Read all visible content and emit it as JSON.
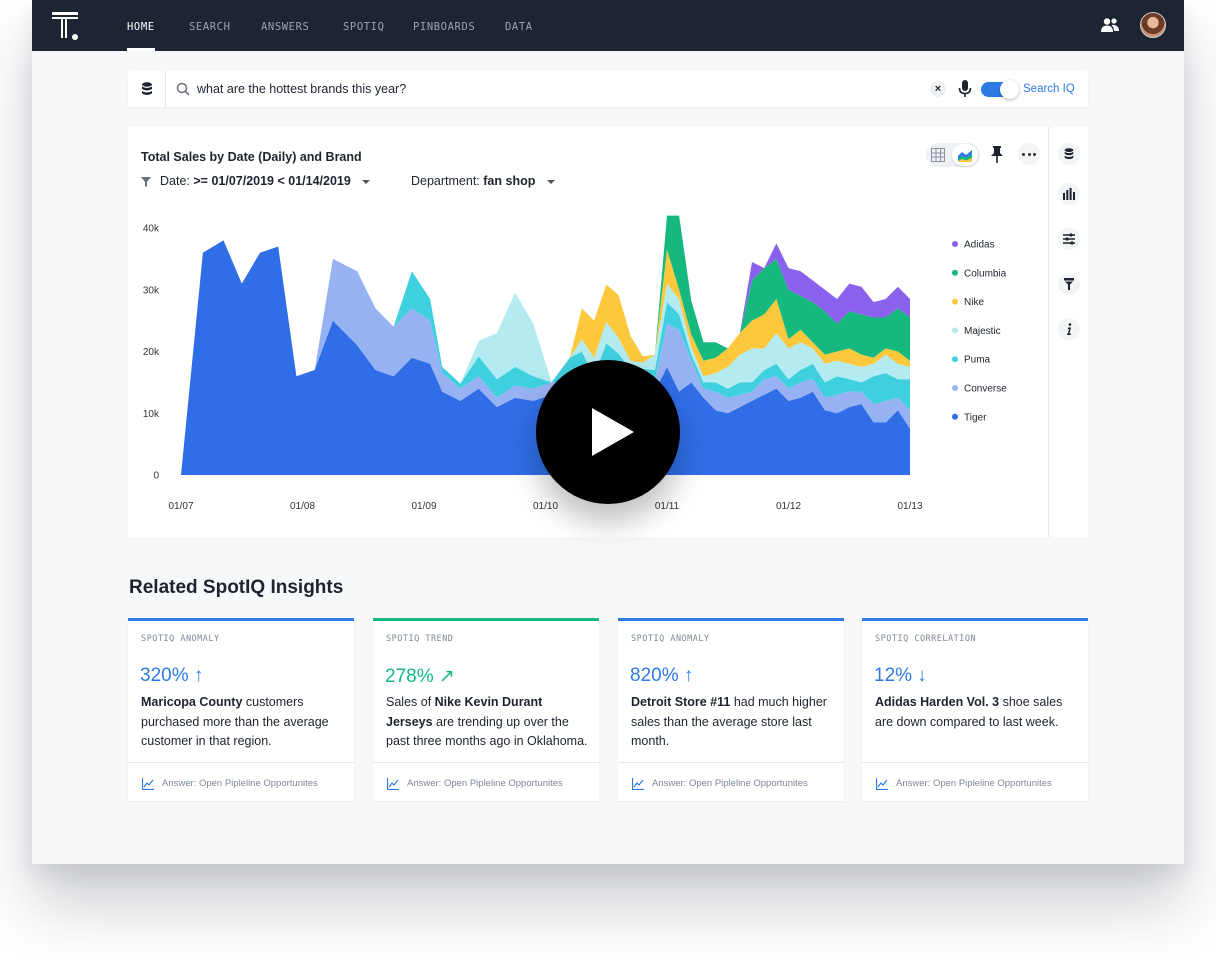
{
  "nav": {
    "items": [
      "HOME",
      "SEARCH",
      "ANSWERS",
      "SPOTIQ",
      "PINBOARDS",
      "DATA"
    ],
    "active": "HOME"
  },
  "search": {
    "query": "what are the hottest brands this year?",
    "clear_label": "×",
    "search_iq_label": "Search IQ",
    "search_iq_enabled": true
  },
  "chart_card": {
    "title": "Total Sales by Date (Daily) and Brand",
    "filters": [
      {
        "label": "Date:",
        "value": ">= 01/07/2019 < 01/14/2019"
      },
      {
        "label": "Department:",
        "value": "fan shop"
      }
    ]
  },
  "chart_data": {
    "type": "area",
    "stacked": true,
    "title": "Total Sales by Date (Daily) and Brand",
    "x_ticks": [
      "01/07",
      "01/08",
      "01/09",
      "01/10",
      "01/11",
      "01/12",
      "01/13"
    ],
    "y_ticks": [
      "0",
      "10k",
      "20k",
      "30k",
      "40k"
    ],
    "ylim": [
      0,
      40000
    ],
    "legend_position": "right",
    "x": [
      0,
      0.18,
      0.35,
      0.5,
      0.65,
      0.8,
      0.95,
      1.1,
      1.25,
      1.45,
      1.6,
      1.75,
      1.9,
      2.05,
      2.15,
      2.3,
      2.45,
      2.6,
      2.75,
      2.9,
      3.05,
      3.2,
      3.3,
      3.4,
      3.5,
      3.6,
      3.7,
      3.8,
      3.9,
      4.0,
      4.1,
      4.2,
      4.3,
      4.4,
      4.5,
      4.6,
      4.7,
      4.8,
      4.9,
      5.0,
      5.1,
      5.2,
      5.3,
      5.4,
      5.5,
      5.6,
      5.7,
      5.8,
      5.9,
      6.0
    ],
    "series": [
      {
        "name": "Tiger",
        "color": "#2f6ee6",
        "values": [
          0,
          36000,
          38000,
          31000,
          36000,
          37000,
          16000,
          17000,
          25000,
          21000,
          17000,
          16000,
          19000,
          18000,
          13500,
          12000,
          14000,
          11000,
          12500,
          12000,
          13000,
          13500,
          12000,
          11500,
          15500,
          14500,
          13500,
          14000,
          13500,
          17500,
          13500,
          15000,
          12500,
          10500,
          10000,
          11000,
          12000,
          13000,
          14000,
          12000,
          12500,
          13500,
          10500,
          10000,
          11000,
          11500,
          8500,
          8500,
          10500,
          7500
        ]
      },
      {
        "name": "Converse",
        "color": "#97b2f3",
        "values": [
          0,
          0,
          0,
          0,
          0,
          0,
          0,
          0,
          10000,
          12000,
          10000,
          8000,
          8000,
          7000,
          3000,
          2000,
          2000,
          1500,
          2000,
          2000,
          2000,
          1500,
          2500,
          1500,
          1800,
          2200,
          2000,
          2200,
          2000,
          7000,
          10000,
          3500,
          1500,
          3000,
          2500,
          2000,
          1500,
          2500,
          2000,
          2000,
          2500,
          2000,
          2000,
          3000,
          2500,
          2000,
          3000,
          3500,
          2000,
          3000
        ]
      },
      {
        "name": "Puma",
        "color": "#3fd0e0",
        "values": [
          0,
          0,
          0,
          0,
          0,
          0,
          0,
          0,
          0,
          0,
          0,
          0,
          6000,
          3500,
          1000,
          800,
          3200,
          3000,
          3000,
          2000,
          0,
          4000,
          5500,
          3000,
          4000,
          3000,
          1500,
          1000,
          1500,
          3500,
          2500,
          1000,
          1000,
          1500,
          1500,
          2000,
          1500,
          1500,
          2000,
          1500,
          2000,
          2500,
          2500,
          3000,
          2000,
          1500,
          4500,
          4500,
          3000,
          5000
        ]
      },
      {
        "name": "Majestic",
        "color": "#b3ebf0",
        "values": [
          0,
          0,
          0,
          0,
          0,
          0,
          0,
          0,
          0,
          0,
          0,
          0,
          0,
          0,
          0,
          0,
          2500,
          7500,
          12000,
          8500,
          0,
          0,
          2000,
          3000,
          3500,
          2500,
          1500,
          1000,
          2500,
          3000,
          2500,
          1200,
          1000,
          1500,
          3500,
          4500,
          5500,
          3500,
          5000,
          5000,
          4500,
          2500,
          3000,
          2500,
          2500,
          2500,
          2000,
          3000,
          2500,
          2000
        ]
      },
      {
        "name": "Nike",
        "color": "#fec83d",
        "values": [
          0,
          0,
          0,
          0,
          0,
          0,
          0,
          0,
          0,
          0,
          0,
          0,
          0,
          0,
          0,
          0,
          0,
          0,
          0,
          0,
          0,
          0,
          5000,
          6000,
          6000,
          7000,
          4000,
          1000,
          0,
          5500,
          1500,
          2000,
          2500,
          2500,
          3000,
          3500,
          4500,
          5500,
          5500,
          1500,
          2000,
          1000,
          1500,
          1500,
          2500,
          2000,
          1000,
          1000,
          2000,
          1000
        ]
      },
      {
        "name": "Columbia",
        "color": "#16b97d",
        "values": [
          0,
          0,
          0,
          0,
          0,
          0,
          0,
          0,
          0,
          0,
          0,
          0,
          0,
          0,
          0,
          0,
          0,
          0,
          0,
          0,
          0,
          0,
          0,
          0,
          0,
          0,
          0,
          0,
          0,
          5500,
          12000,
          5500,
          3000,
          2500,
          0,
          0,
          6500,
          7500,
          6500,
          8000,
          5500,
          6500,
          7000,
          4500,
          6000,
          6500,
          6500,
          5000,
          7000,
          7000
        ]
      },
      {
        "name": "Adidas",
        "color": "#8a61ec",
        "values": [
          0,
          0,
          0,
          0,
          0,
          0,
          0,
          0,
          0,
          0,
          0,
          0,
          0,
          0,
          0,
          0,
          0,
          0,
          0,
          0,
          0,
          0,
          0,
          0,
          0,
          0,
          0,
          0,
          0,
          0,
          0,
          0,
          0,
          0,
          0,
          0,
          3000,
          0,
          2500,
          3500,
          4000,
          3500,
          3500,
          4000,
          4500,
          4500,
          2500,
          3000,
          3500,
          3000
        ]
      }
    ]
  },
  "insights": {
    "title": "Related SpotIQ Insights",
    "cards": [
      {
        "kind": "SPOTIQ ANOMALY",
        "value": "320% ↑",
        "bold": "Maricopa County",
        "text": " customers purchased more than the average customer in that region.",
        "pre": "",
        "footer": "Answer: Open Pipleline Opportunites",
        "accent": "blue"
      },
      {
        "kind": "SPOTIQ TREND",
        "value": "278% ↗",
        "pre": "Sales of ",
        "bold": "Nike Kevin Durant Jerseys",
        "text": " are trending up over the past three months ago in Oklahoma.",
        "footer": "Answer: Open Pipleline Opportunites",
        "accent": "green"
      },
      {
        "kind": "SPOTIQ ANOMALY",
        "value": "820% ↑",
        "pre": "",
        "bold": "Detroit Store #11",
        "text": " had much higher sales than the average store last month.",
        "footer": "Answer: Open Pipleline Opportunites",
        "accent": "blue"
      },
      {
        "kind": "SPOTIQ CORRELATION",
        "value": "12% ↓",
        "pre": "",
        "bold": "Adidas Harden Vol. 3",
        "text": " shoe sales are down compared to last week.",
        "footer": "Answer: Open Pipleline Opportunites",
        "accent": "blue"
      }
    ]
  },
  "icons": {
    "logo": "thoughtspot-logo",
    "people": "people-icon",
    "database": "database-icon",
    "search": "search-icon",
    "mic": "mic-icon",
    "pin": "pin-icon",
    "more": "more-icon",
    "play": "play-icon"
  }
}
